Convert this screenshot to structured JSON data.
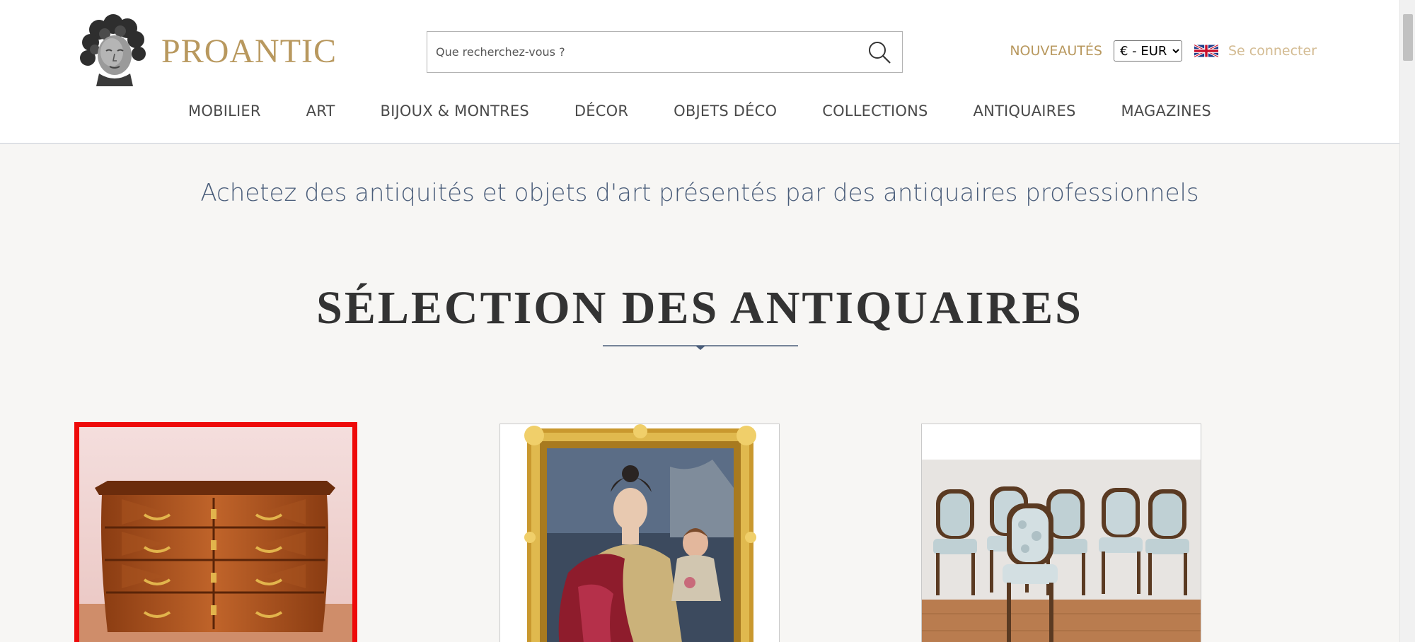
{
  "header": {
    "logo_text": "PROANTIC",
    "search": {
      "placeholder": "Que recherchez-vous ?",
      "value": ""
    },
    "nouveautes_label": "NOUVEAUTÉS",
    "currency": {
      "selected": "€ - EUR"
    },
    "language_flag": "uk-flag-icon",
    "login_label": "Se connecter"
  },
  "nav": {
    "items": [
      {
        "label": "MOBILIER"
      },
      {
        "label": "ART"
      },
      {
        "label": "BIJOUX & MONTRES"
      },
      {
        "label": "DÉCOR"
      },
      {
        "label": "OBJETS DÉCO"
      },
      {
        "label": "COLLECTIONS"
      },
      {
        "label": "ANTIQUAIRES"
      },
      {
        "label": "MAGAZINES"
      }
    ]
  },
  "main": {
    "tagline": "Achetez des antiquités et objets d'art présentés par des antiquaires professionnels",
    "section_title": "SÉLECTION DES ANTIQUAIRES",
    "products": [
      {
        "image": "walnut-commode-image",
        "highlighted": true
      },
      {
        "image": "portrait-painting-image",
        "highlighted": false
      },
      {
        "image": "set-of-chairs-image",
        "highlighted": false
      }
    ]
  },
  "colors": {
    "gold": "#b8985e",
    "gold_light": "#d3bb92",
    "tagline_blue": "#4a5d7a",
    "highlight_red": "#ee0a0a",
    "page_bg": "#f7f6f4"
  }
}
